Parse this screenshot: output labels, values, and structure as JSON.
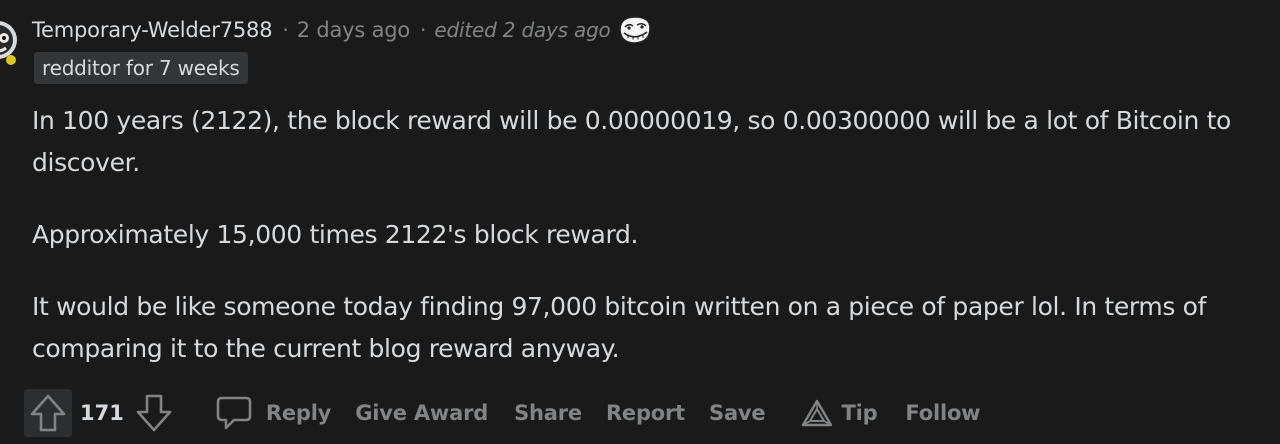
{
  "comment": {
    "author": "Temporary-Welder7588",
    "separator": "·",
    "posted": "2 days ago",
    "edited": "edited 2 days ago",
    "flair": "redditor for 7 weeks",
    "paragraphs": [
      "In 100 years (2122), the block reward will be 0.00000019, so 0.00300000 will be a lot of Bitcoin to discover.",
      "Approximately 15,000 times 2122's block reward.",
      "It would be like someone today finding 97,000 bitcoin written on a piece of paper lol. In terms of comparing it to the current blog reward anyway."
    ]
  },
  "actions": {
    "score": "171",
    "reply": "Reply",
    "give_award": "Give Award",
    "share": "Share",
    "report": "Report",
    "save": "Save",
    "tip": "Tip",
    "follow": "Follow"
  },
  "icons": {
    "avatar": "avatar-icon",
    "flair_emoji": "trollface-emoji-icon",
    "upvote": "upvote-arrow-icon",
    "downvote": "downvote-arrow-icon",
    "reply": "speech-bubble-icon",
    "tip": "triangle-logo-icon"
  },
  "colors": {
    "background": "#1a1a1b",
    "text": "#d7dadc",
    "muted": "#818384",
    "flair_bg": "#343536"
  }
}
